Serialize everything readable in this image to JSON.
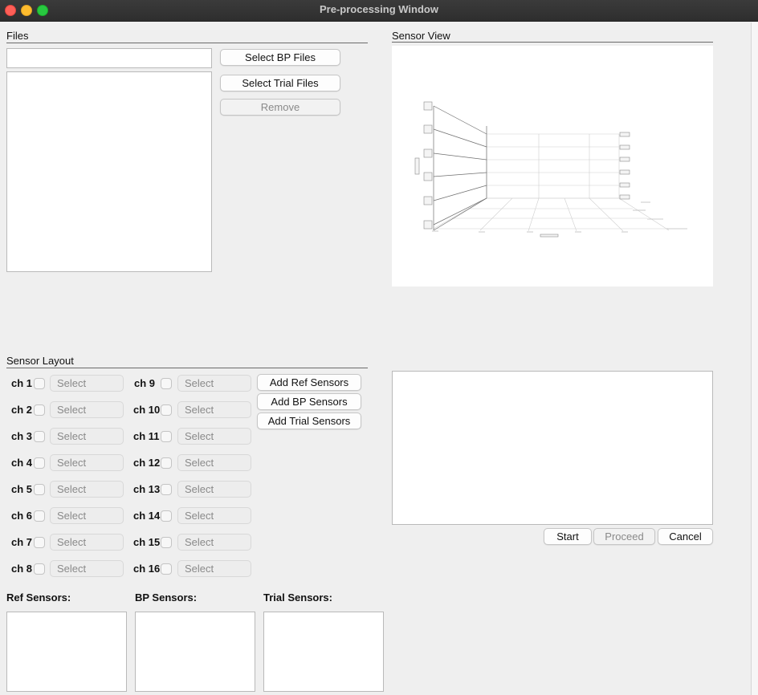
{
  "window": {
    "title": "Pre-processing Window"
  },
  "files": {
    "section_label": "Files",
    "path_value": "",
    "select_bp_label": "Select BP Files",
    "select_trial_label": "Select Trial Files",
    "remove_label": "Remove"
  },
  "sensor_view": {
    "section_label": "Sensor View"
  },
  "sensor_layout": {
    "section_label": "Sensor Layout",
    "select_placeholder": "Select",
    "channels_left": [
      "ch 1",
      "ch 2",
      "ch 3",
      "ch 4",
      "ch 5",
      "ch 6",
      "ch 7",
      "ch 8"
    ],
    "channels_right": [
      "ch 9",
      "ch 10",
      "ch 11",
      "ch 12",
      "ch 13",
      "ch 14",
      "ch 15",
      "ch 16"
    ],
    "add_ref_label": "Add Ref Sensors",
    "add_bp_label": "Add BP Sensors",
    "add_trial_label": "Add Trial Sensors"
  },
  "sensor_lists": {
    "ref_label": "Ref Sensors:",
    "bp_label": "BP Sensors:",
    "trial_label": "Trial Sensors:"
  },
  "actions": {
    "start_label": "Start",
    "proceed_label": "Proceed",
    "cancel_label": "Cancel"
  },
  "colors": {
    "titlebar": "#2e2e2e",
    "window_bg": "#efefef",
    "close": "#fe5f57",
    "minimize": "#febc2e",
    "maximize": "#28c840"
  }
}
